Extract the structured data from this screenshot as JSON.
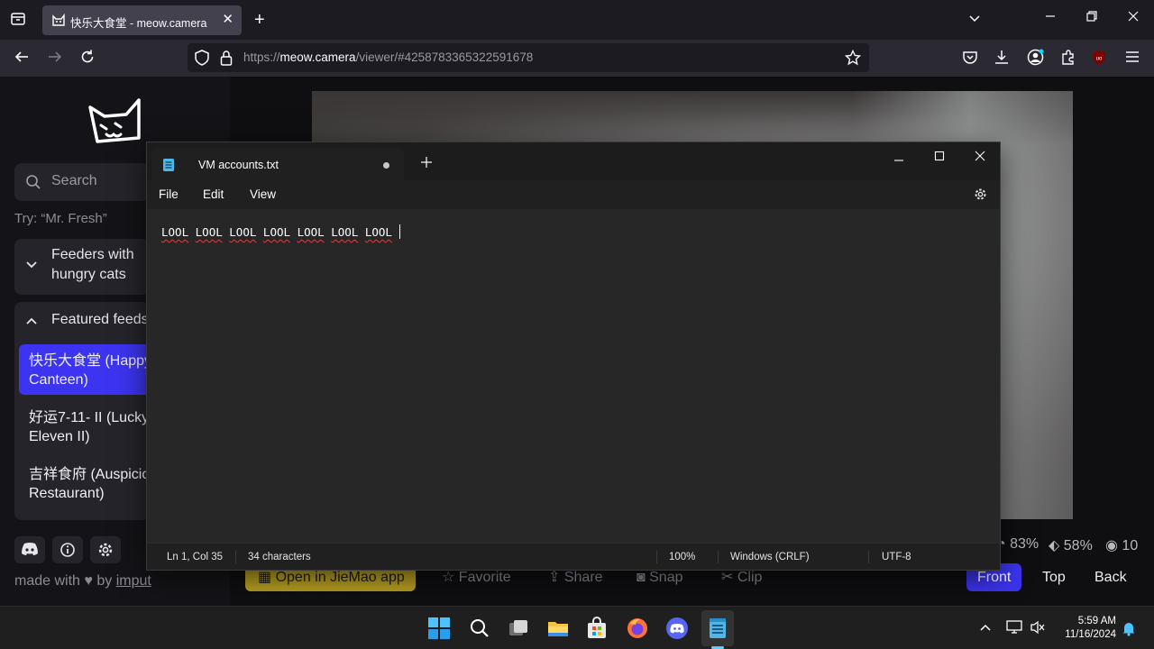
{
  "browser": {
    "tab_title": "快乐大食堂 - meow.camera",
    "url_prefix": "https://",
    "url_host": "meow.camera",
    "url_path": "/viewer/#4258783365322591678"
  },
  "sidebar": {
    "search_placeholder": "Search",
    "try_hint": "Try: “Mr. Fresh”",
    "group1_line1": "Feeders with",
    "group1_line2": "hungry cats",
    "group2": "Featured feeds",
    "feeds": [
      {
        "line1": "快乐大食堂 (Happy",
        "line2": "Canteen)"
      },
      {
        "line1": "好运7-11- II (Lucky",
        "line2": "Eleven II)"
      },
      {
        "line1": "吉祥食府 (Auspicious",
        "line2": "Restaurant)"
      }
    ],
    "made_with": "made with",
    "by": "by",
    "imput": "imput"
  },
  "stats": {
    "food": "83%",
    "battery": "58%",
    "viewers": "10"
  },
  "actions": {
    "open_app": "Open in JieMao app",
    "favorite": "Favorite",
    "share": "Share",
    "snap": "Snap",
    "clip": "Clip",
    "front": "Front",
    "top": "Top",
    "back": "Back"
  },
  "notepad": {
    "tab_name": "VM accounts.txt",
    "menu": {
      "file": "File",
      "edit": "Edit",
      "view": "View"
    },
    "words": [
      "LOOL",
      "LOOL",
      "LOOL",
      "LOOL",
      "LOOL",
      "LOOL",
      "LOOL"
    ],
    "status": {
      "position": "Ln 1, Col 35",
      "chars": "34 characters",
      "zoom": "100%",
      "line_ending": "Windows (CRLF)",
      "encoding": "UTF-8"
    }
  },
  "taskbar": {
    "time": "5:59 AM",
    "date": "11/16/2024"
  }
}
